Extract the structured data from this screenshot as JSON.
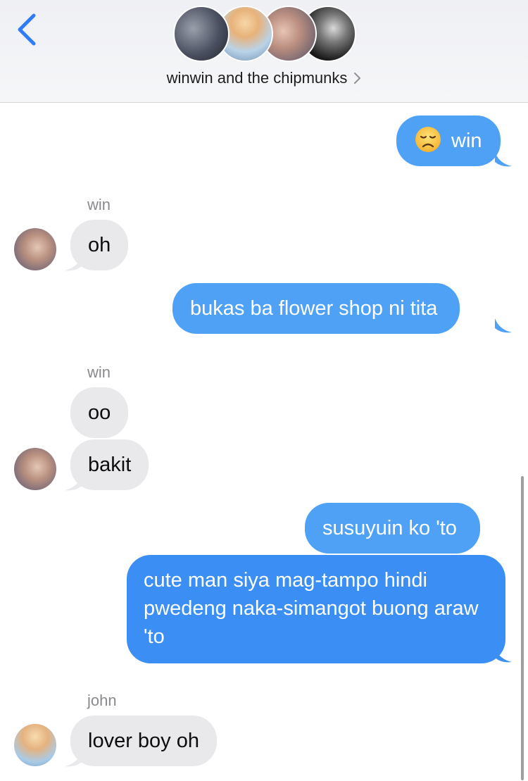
{
  "header": {
    "group_name": "winwin and the chipmunks"
  },
  "messages": [
    {
      "sender": "me",
      "emoji": "disappointed-face",
      "text": "win"
    },
    {
      "sender": "win",
      "name": "win",
      "text": "oh"
    },
    {
      "sender": "me",
      "text": "bukas ba flower shop ni tita"
    },
    {
      "sender": "win",
      "name": "win",
      "text": "oo"
    },
    {
      "sender": "win",
      "text": "bakit"
    },
    {
      "sender": "me",
      "text": "susuyuin ko 'to"
    },
    {
      "sender": "me",
      "text": "cute man siya mag-tampo hindi pwedeng naka-simangot buong araw 'to"
    },
    {
      "sender": "john",
      "name": "john",
      "text": "lover boy oh"
    }
  ],
  "colors": {
    "outgoing_bubble": "#4ea1f5",
    "outgoing_bubble_bottom": "#3b8ff4",
    "incoming_bubble": "#e9e9eb",
    "back_chevron": "#2f7cf6",
    "sender_name": "#8a8a8e"
  },
  "icons": {
    "back": "chevron-left-icon",
    "title_disclosure": "chevron-right-icon",
    "emoji": "disappointed-face-icon"
  }
}
